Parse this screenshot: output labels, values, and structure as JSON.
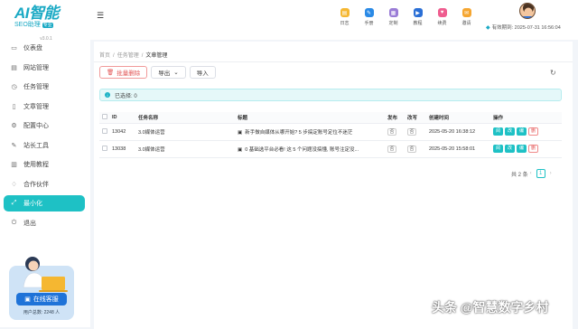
{
  "logo": {
    "title": "AI智能",
    "subtitle": "SEO助理",
    "badge": "专业",
    "version": "v3.0.1"
  },
  "sidebar": {
    "items": [
      {
        "label": "仪表盘",
        "icon": "monitor-icon"
      },
      {
        "label": "网站管理",
        "icon": "folder-icon"
      },
      {
        "label": "任务管理",
        "icon": "clock-icon"
      },
      {
        "label": "文章管理",
        "icon": "document-icon"
      },
      {
        "label": "配置中心",
        "icon": "gear-icon"
      },
      {
        "label": "站长工具",
        "icon": "wrench-icon"
      },
      {
        "label": "使用教程",
        "icon": "book-icon"
      },
      {
        "label": "合作伙伴",
        "icon": "handshake-icon"
      },
      {
        "label": "最小化",
        "icon": "minimize-icon"
      },
      {
        "label": "退出",
        "icon": "power-icon"
      }
    ],
    "active_index": 8,
    "promo": {
      "button": "在线客服",
      "users_label": "用户总数: 2248 人"
    }
  },
  "topbar": {
    "tools": [
      {
        "label": "日志",
        "color": "#f5b731"
      },
      {
        "label": "手册",
        "color": "#2a8ae6"
      },
      {
        "label": "定制",
        "color": "#9a7cd6"
      },
      {
        "label": "教程",
        "color": "#2a6fd6"
      },
      {
        "label": "续费",
        "color": "#ef5d8f"
      },
      {
        "label": "邀请",
        "color": "#f5a631"
      }
    ],
    "expiry": "有效期到: 2025-07-31 16:56:04"
  },
  "breadcrumb": [
    "首页",
    "任务管理",
    "文章管理"
  ],
  "actions": {
    "batch_delete": "批量删除",
    "export": "导出",
    "import": "导入"
  },
  "selected_info": "已选择: 0",
  "table": {
    "headers": [
      "ID",
      "任务名称",
      "标题",
      "发布",
      "改写",
      "创建时间",
      "操作"
    ],
    "rows": [
      {
        "id": "13042",
        "task": "3.0媒体运营",
        "title": "新手做自媒体从哪开始? 5 步搞定账号定位不迷茫",
        "publish": "否",
        "rewrite": "否",
        "created": "2025-05-20 16:38:12"
      },
      {
        "id": "13038",
        "task": "3.0媒体运营",
        "title": "0 基础选平台必看! 这 5 个问题没搞懂, 账号注定没...",
        "publish": "否",
        "rewrite": "否",
        "created": "2025-05-20 15:58:01"
      }
    ],
    "op_labels": [
      "阅",
      "改",
      "编",
      "删"
    ]
  },
  "pager": {
    "total": "共 2 条",
    "page": "1"
  },
  "watermark": "头条 @智慧数字乡村"
}
